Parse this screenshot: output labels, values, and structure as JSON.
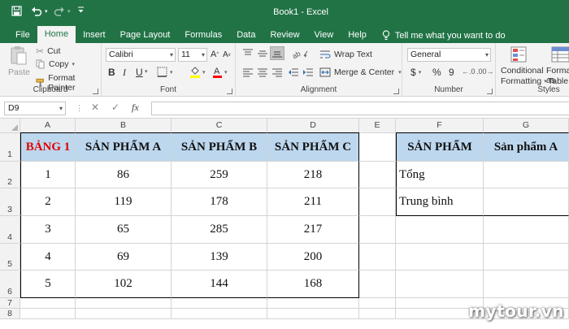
{
  "window": {
    "title": "Book1  -  Excel",
    "accent": "#217346"
  },
  "quick_access": {
    "save": "save-icon",
    "undo": "undo-icon",
    "redo": "redo-icon",
    "customize": "customize-icon"
  },
  "tabs": [
    "File",
    "Home",
    "Insert",
    "Page Layout",
    "Formulas",
    "Data",
    "Review",
    "View",
    "Help"
  ],
  "active_tab": "Home",
  "tell_me": "Tell me what you want to do",
  "ribbon": {
    "clipboard": {
      "label": "Clipboard",
      "paste": "Paste",
      "cut": "Cut",
      "copy": "Copy",
      "format_painter": "Format Painter"
    },
    "font": {
      "label": "Font",
      "name": "Calibri",
      "size": "11",
      "bold": "B",
      "italic": "I",
      "underline": "U"
    },
    "alignment": {
      "label": "Alignment",
      "wrap": "Wrap Text",
      "merge": "Merge & Center"
    },
    "number": {
      "label": "Number",
      "format": "General",
      "currency": "$",
      "percent": "%",
      "comma": "9"
    },
    "styles": {
      "label": "Styles",
      "conditional": "Conditional",
      "conditional2": "Formatting",
      "format_as": "Format as",
      "table": "Table"
    }
  },
  "formula_bar": {
    "name_box": "D9",
    "fx": "fx",
    "value": ""
  },
  "columns": [
    "A",
    "B",
    "C",
    "D",
    "E",
    "F",
    "G"
  ],
  "rows": [
    "1",
    "2",
    "3",
    "4",
    "5",
    "6",
    "7",
    "8"
  ],
  "table1": {
    "headers": [
      "BẢNG 1",
      "SẢN PHẨM A",
      "SẢN PHẨM B",
      "SẢN PHẨM C"
    ],
    "body": [
      [
        "1",
        "86",
        "259",
        "218"
      ],
      [
        "2",
        "119",
        "178",
        "211"
      ],
      [
        "3",
        "65",
        "285",
        "217"
      ],
      [
        "4",
        "69",
        "139",
        "200"
      ],
      [
        "5",
        "102",
        "144",
        "168"
      ]
    ]
  },
  "table2": {
    "headers": [
      "SẢN PHẨM",
      "Sản phẩm A"
    ],
    "body": [
      [
        "Tổng",
        ""
      ],
      [
        "Trung bình",
        ""
      ]
    ]
  },
  "watermark": "mytour.vn"
}
